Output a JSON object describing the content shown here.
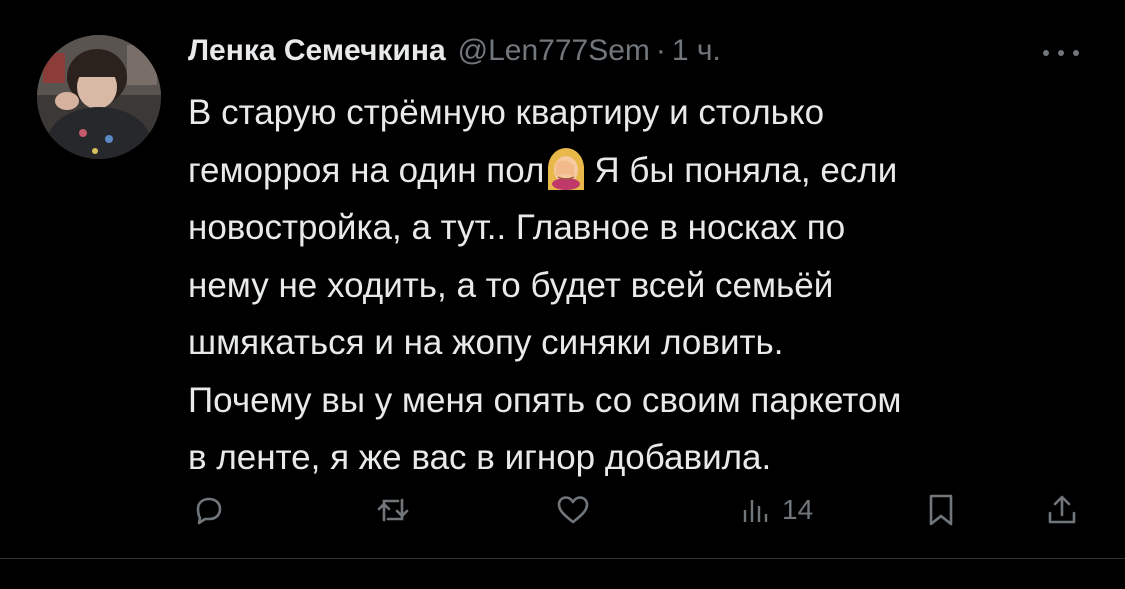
{
  "tweet": {
    "author_name": "Ленка Семечкина",
    "handle": "@Len777Sem",
    "separator": "·",
    "time": "1 ч.",
    "lines": [
      "В старую стрёмную квартиру и столько",
      "геморроя на один пол",
      "Я бы поняла, если",
      "новостройка, а тут.. Главное в носках по",
      "нему не ходить, а то будет всей семьёй",
      "шмякаться и на жопу синяки ловить.",
      "Почему вы у меня опять со своим паркетом",
      "в ленте, я же вас в игнор добавила."
    ],
    "emoji": "face-palm-woman-emoji"
  },
  "actions": {
    "reply_icon": "reply-icon",
    "retweet_icon": "retweet-icon",
    "like_icon": "heart-icon",
    "views_icon": "views-bar-chart-icon",
    "views_count": "14",
    "bookmark_icon": "bookmark-icon",
    "share_icon": "share-icon"
  },
  "colors": {
    "background": "#000000",
    "text_primary": "#e7e9ea",
    "text_secondary": "#71767b",
    "divider": "#2f3336"
  }
}
